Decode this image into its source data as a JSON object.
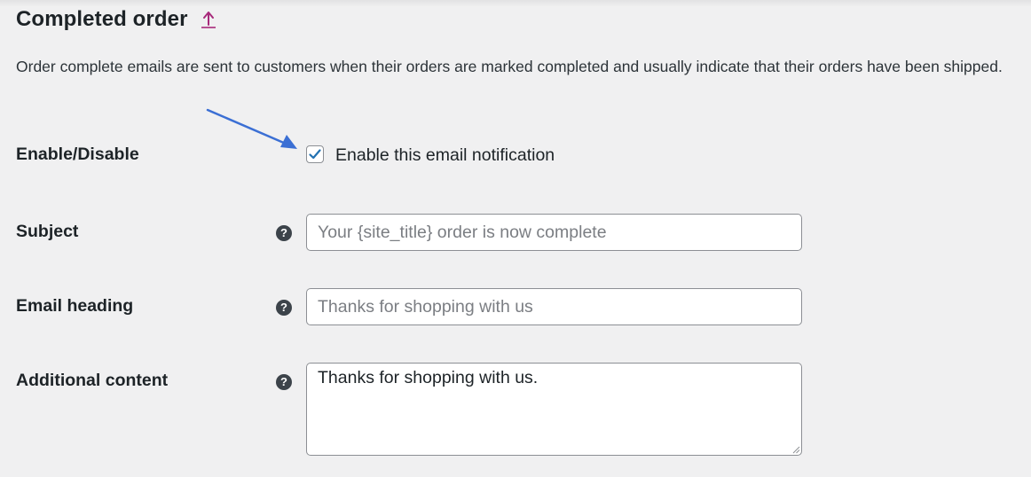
{
  "section": {
    "title": "Completed order",
    "description": "Order complete emails are sent to customers when their orders are marked completed and usually indicate that their orders have been shipped."
  },
  "enable": {
    "label": "Enable/Disable",
    "checkbox_label": "Enable this email notification",
    "checked": true
  },
  "subject": {
    "label": "Subject",
    "value": "",
    "placeholder": "Your {site_title} order is now complete"
  },
  "email_heading": {
    "label": "Email heading",
    "value": "",
    "placeholder": "Thanks for shopping with us"
  },
  "additional_content": {
    "label": "Additional content",
    "value": "Thanks for shopping with us."
  },
  "help_icon_glyph": "?",
  "colors": {
    "accent": "#2271b1",
    "link": "#a7297b",
    "annotation_arrow": "#3b6fd4",
    "background": "#f0f0f1"
  }
}
